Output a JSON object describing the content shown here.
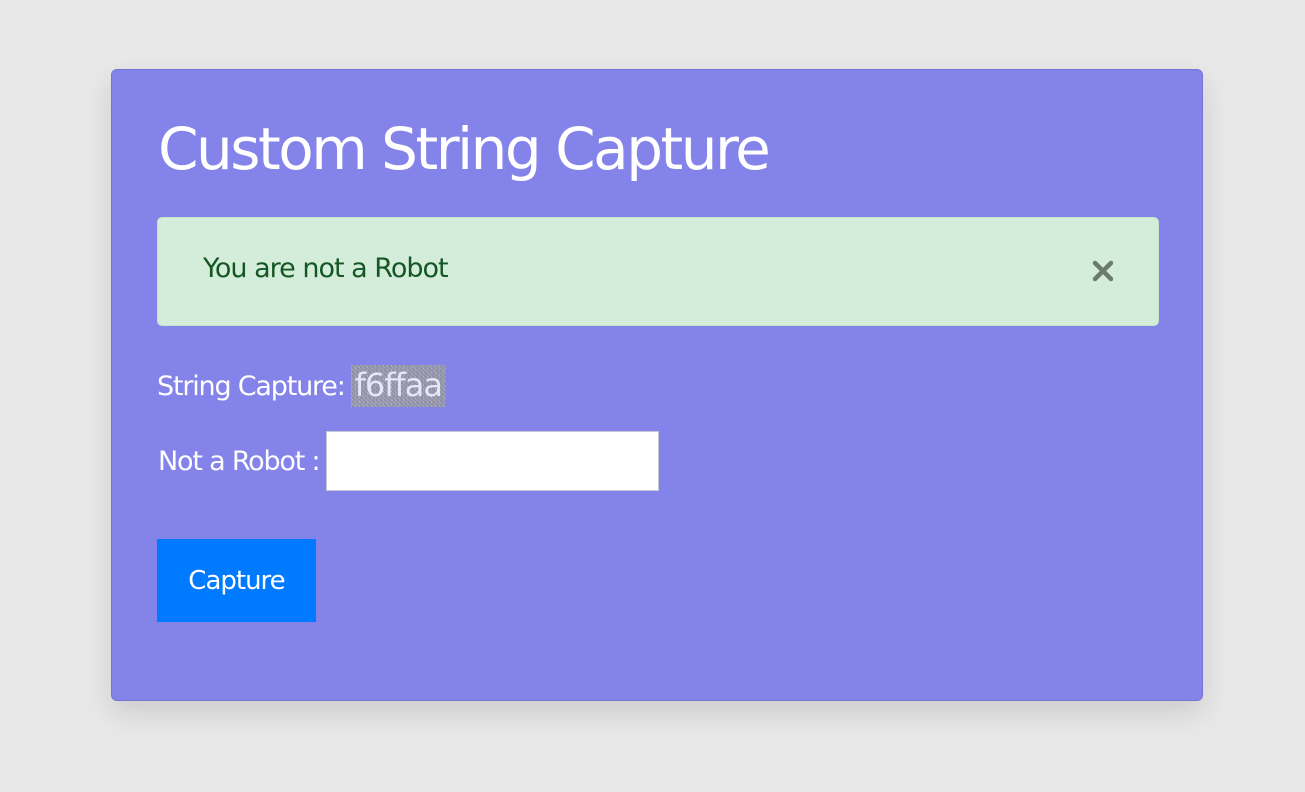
{
  "page": {
    "title": "Custom String Capture"
  },
  "alert": {
    "message": "You are not a Robot",
    "close_icon": "close-icon",
    "colors": {
      "background": "#d4edda",
      "text": "#155724"
    }
  },
  "capture": {
    "label": "String Capture:",
    "code": "f6ffaa"
  },
  "robot": {
    "label": "Not a Robot :",
    "value": "",
    "placeholder": ""
  },
  "button": {
    "label": "Capture",
    "color": "#007bff"
  },
  "colors": {
    "page_background": "#e8e8e8",
    "card_background": "#8383ea"
  }
}
